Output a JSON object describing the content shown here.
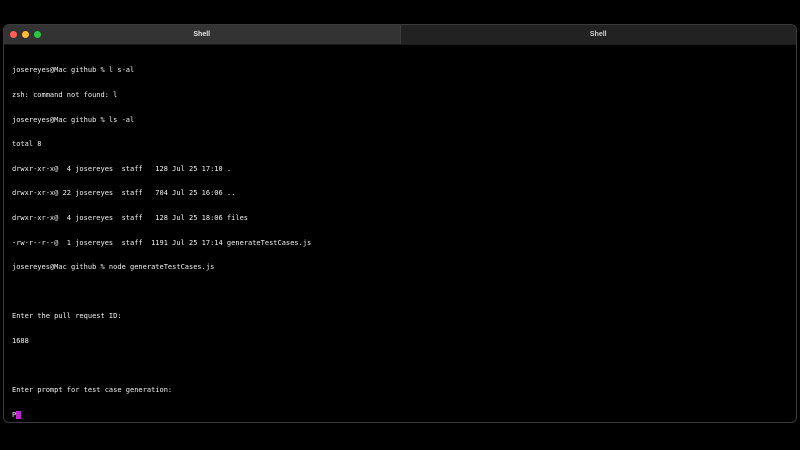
{
  "tabs": [
    {
      "label": "Shell",
      "active": true
    },
    {
      "label": "Shell",
      "active": false
    }
  ],
  "window_controls": {
    "close_color": "#ff5f57",
    "minimize_color": "#febc2e",
    "maximize_color": "#28c840"
  },
  "terminal": {
    "lines": [
      "josereyes@Mac github % l s-al",
      "zsh: command not found: l",
      "josereyes@Mac github % ls -al",
      "total 8",
      "drwxr-xr-x@  4 josereyes  staff   128 Jul 25 17:10 .",
      "drwxr-xr-x@ 22 josereyes  staff   704 Jul 25 16:06 ..",
      "drwxr-xr-x@  4 josereyes  staff   128 Jul 25 18:06 files",
      "-rw-r--r--@  1 josereyes  staff  1191 Jul 25 17:14 generateTestCases.js",
      "josereyes@Mac github % node generateTestCases.js",
      "",
      "Enter the pull request ID:",
      "1688",
      "",
      "Enter prompt for test case generation:",
      "P"
    ],
    "cursor_color": "#c026d3"
  }
}
